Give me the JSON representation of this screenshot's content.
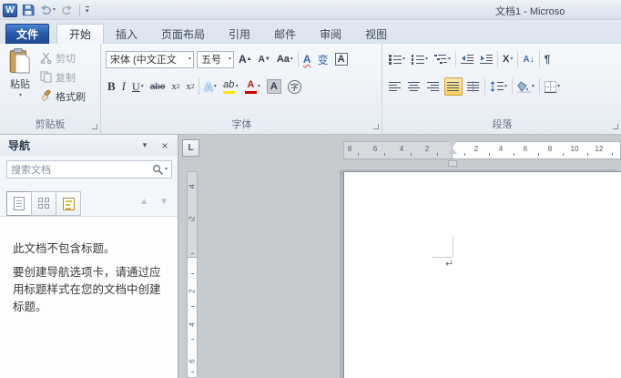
{
  "window": {
    "title": "文档1 - Microso"
  },
  "tabs": {
    "file": "文件",
    "items": [
      "开始",
      "插入",
      "页面布局",
      "引用",
      "邮件",
      "审阅",
      "视图"
    ],
    "active": "开始"
  },
  "ribbon": {
    "clipboard": {
      "label": "剪贴板",
      "paste": "粘贴",
      "cut": "剪切",
      "copy": "复制",
      "format_painter": "格式刷"
    },
    "font": {
      "label": "字体",
      "name": "宋体 (中文正文",
      "size": "五号"
    },
    "paragraph": {
      "label": "段落"
    }
  },
  "glyphs": {
    "dropdown": "▾",
    "up_arrow": "▲",
    "down_arrow": "▼",
    "close": "×",
    "bold": "B",
    "italic": "I",
    "underline": "U",
    "strikethrough": "abe",
    "sub_base": "x",
    "sub_small": "2",
    "sup_base": "x",
    "sup_small": "2",
    "change_case": "Aa",
    "grow_font": "A",
    "grow_mark": "▲",
    "shrink_font": "A",
    "shrink_mark": "▼",
    "clear_format": "A",
    "phonetic": "变",
    "char_border": "A",
    "text_effects": "A",
    "highlight": "ab",
    "font_color": "A",
    "char_shading": "A",
    "enclose": "字",
    "asian_layout": "X",
    "sort": "A",
    "sort_arrow": "↓",
    "pilcrow": "¶",
    "return_mark": "↵",
    "word_logo": "W",
    "tab_selector": "L"
  },
  "navigation": {
    "title": "导航",
    "search_placeholder": "搜索文档",
    "empty_title": "此文档不包含标题。",
    "empty_hint": "要创建导航选项卡，请通过应用标题样式在您的文档中创建标题。"
  },
  "ruler": {
    "h_margin": [
      "8",
      "6",
      "4",
      "2"
    ],
    "h_main": [
      "2",
      "4",
      "6",
      "8",
      "10",
      "12"
    ],
    "v_margin": [
      "4",
      "2"
    ],
    "v_main": [
      "2",
      "4",
      "6"
    ]
  },
  "colors": {
    "file_tab_blue": "#2a5cab",
    "selected_button_orange": "#fbd15e",
    "highlight_yellow": "#ffe200",
    "font_color_red": "#d00000",
    "page_white": "#ffffff"
  }
}
